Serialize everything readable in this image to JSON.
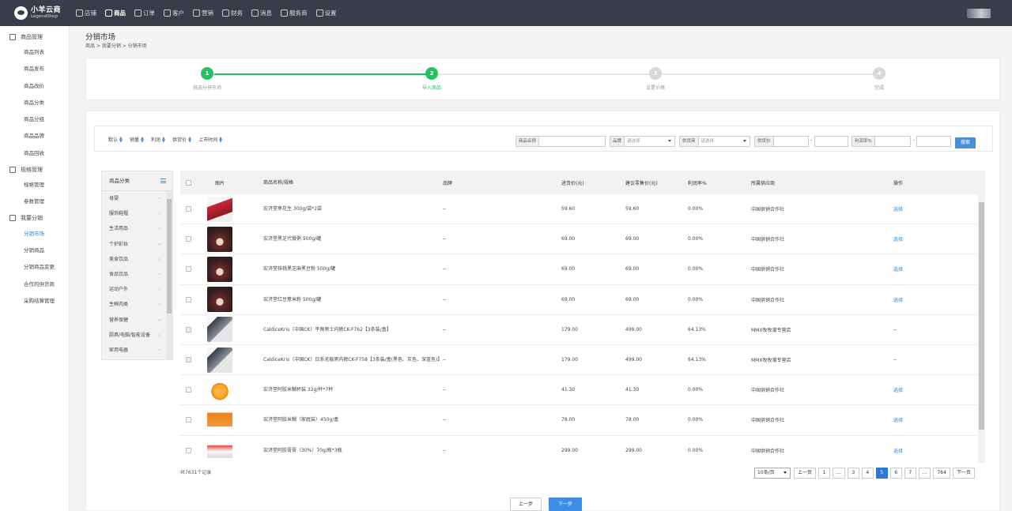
{
  "brand": {
    "name": "小羊云商",
    "sub": "LegendShop"
  },
  "topnav": [
    {
      "label": "店铺",
      "active": false
    },
    {
      "label": "商品",
      "active": true
    },
    {
      "label": "订单",
      "active": false
    },
    {
      "label": "客户",
      "active": false
    },
    {
      "label": "营销",
      "active": false
    },
    {
      "label": "财务",
      "active": false
    },
    {
      "label": "消息",
      "active": false
    },
    {
      "label": "服务商",
      "active": false
    },
    {
      "label": "设置",
      "active": false
    }
  ],
  "sidebar": {
    "groups": [
      {
        "label": "商品管理",
        "items": [
          "商品列表",
          "商品发布",
          "商品改价",
          "商品分类",
          "商品分组",
          "商品品牌",
          "商品回收"
        ]
      },
      {
        "label": "规格管理",
        "items": [
          "规格管理",
          "参数管理"
        ]
      },
      {
        "label": "我要分销",
        "items": [
          "分销市场",
          "分销商品",
          "分销商品变更",
          "合作的供货商",
          "采购结算管理"
        ]
      }
    ],
    "active_item": "分销市场"
  },
  "page": {
    "title": "分销市场",
    "breadcrumb": "商品 > 我要分销 > 分销市场"
  },
  "steps": [
    {
      "num": "1",
      "label": "挑选分销市场",
      "state": "done"
    },
    {
      "num": "2",
      "label": "导入商品",
      "state": "current"
    },
    {
      "num": "3",
      "label": "设置价格",
      "state": "todo"
    },
    {
      "num": "4",
      "label": "完成",
      "state": "todo"
    }
  ],
  "filters": {
    "sorts": [
      "默认",
      "销量",
      "利润",
      "供货价",
      "上市时间"
    ],
    "name_label": "商品名称",
    "brand_label": "品牌",
    "brand_placeholder": "请选择",
    "supplier_label": "供货商",
    "supplier_placeholder": "请选择",
    "price_label": "供货价",
    "profit_label": "利润率%",
    "dash": "-",
    "search_label": "搜索"
  },
  "categories": {
    "title": "商品分类",
    "items": [
      "母婴",
      "服饰鞋帽",
      "生活用品",
      "个护彩妆",
      "美食饮品",
      "食品饮品",
      "运动户外",
      "生鲜肉类",
      "营养保健",
      "厨具/电脑/智能设备",
      "家用电器"
    ]
  },
  "table": {
    "headers": {
      "image": "图片",
      "name": "商品名称/规格",
      "brand": "品牌",
      "cost": "进货价(元)",
      "suggest": "建议零售价(元)",
      "profit": "利润率%",
      "supplier": "所属供应商",
      "op": "操作"
    },
    "rows": [
      {
        "img": "t-red",
        "name": "宏济堂枣花生 300g/袋*2袋",
        "brand": "--",
        "cost": "59.60",
        "suggest": "59.60",
        "profit": "0.00%",
        "supplier": "中国供销合作社",
        "op": "选择",
        "disabled": false
      },
      {
        "img": "t-dark",
        "name": "宏济堂黑芝代餐粥 500g/罐",
        "brand": "--",
        "cost": "69.00",
        "suggest": "69.00",
        "profit": "0.00%",
        "supplier": "中国供销合作社",
        "op": "选择",
        "disabled": false
      },
      {
        "img": "t-dark",
        "name": "宏济堂核桃黑芝麻黑豆粉 500g/罐",
        "brand": "--",
        "cost": "69.00",
        "suggest": "69.00",
        "profit": "0.00%",
        "supplier": "中国供销合作社",
        "op": "选择",
        "disabled": false
      },
      {
        "img": "t-dark",
        "name": "宏济堂红豆薏米粉 500g/罐",
        "brand": "--",
        "cost": "69.00",
        "suggest": "69.00",
        "profit": "0.00%",
        "supplier": "中国供销合作社",
        "op": "选择",
        "disabled": false
      },
      {
        "img": "t-grey",
        "name": "CaldiceKris（中国CK）平角男士内裤CK-F762【3条装/盒】",
        "brand": "--",
        "cost": "179.00",
        "suggest": "499.00",
        "profit": "64.13%",
        "supplier": "MMX牧牧潮专营店",
        "op": "--",
        "disabled": true
      },
      {
        "img": "t-grey",
        "name": "CaldiceKris（中国CK）日系无痕男内裤CK-F758【3条装/盒(黑色、灰色、深蓝色)】",
        "brand": "--",
        "cost": "179.00",
        "suggest": "499.00",
        "profit": "64.13%",
        "supplier": "MMX牧牧潮专营店",
        "op": "--",
        "disabled": true
      },
      {
        "img": "t-orange",
        "name": "宏济堂阿胶米糊杯装 32g/杯*7杯",
        "brand": "--",
        "cost": "41.30",
        "suggest": "41.30",
        "profit": "0.00%",
        "supplier": "中国供销合作社",
        "op": "选择",
        "disabled": false
      },
      {
        "img": "t-orange2",
        "name": "宏济堂阿胶米糊（家庭装）450g/盒",
        "brand": "--",
        "cost": "78.00",
        "suggest": "78.00",
        "profit": "0.00%",
        "supplier": "中国供销合作社",
        "op": "选择",
        "disabled": false
      },
      {
        "img": "t-white",
        "name": "宏济堂阿胶膏膏（30%）70g/瓶*3瓶",
        "brand": "--",
        "cost": "299.00",
        "suggest": "299.00",
        "profit": "0.00%",
        "supplier": "中国供销合作社",
        "op": "选择",
        "disabled": false
      }
    ]
  },
  "total_text": "共7631个记录",
  "pagination": {
    "page_size": "10条/页",
    "prev": "上一页",
    "next": "下一页",
    "pages": [
      "1",
      "...",
      "3",
      "4",
      "5",
      "6",
      "7",
      "...",
      "764"
    ],
    "current": "5"
  },
  "footer": {
    "prev_step": "上一步",
    "next_step": "下一步"
  },
  "colors": {
    "topbar": "#393d49",
    "step_done": "#21c25e",
    "link": "#1e88e5",
    "primary_btn": "#3d8ee6",
    "page_active": "#2d7ad6"
  }
}
